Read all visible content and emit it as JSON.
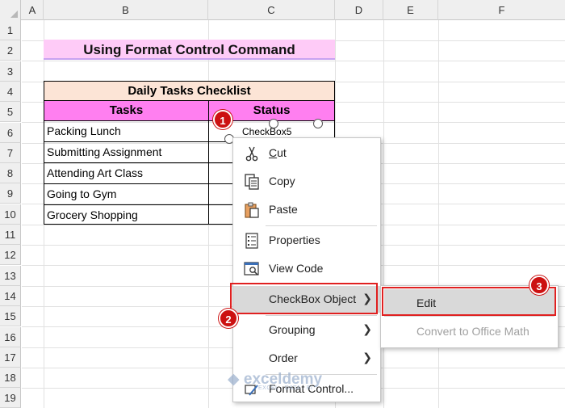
{
  "columns": [
    "A",
    "B",
    "C",
    "D",
    "E",
    "F"
  ],
  "rows": [
    "1",
    "2",
    "3",
    "4",
    "5",
    "6",
    "7",
    "8",
    "9",
    "10",
    "11",
    "12",
    "13",
    "14",
    "15",
    "16",
    "17",
    "18",
    "19"
  ],
  "sheet_title": "Using Format Control Command",
  "table": {
    "header": "Daily Tasks Checklist",
    "col_tasks": "Tasks",
    "col_status": "Status",
    "tasks": [
      "Packing Lunch",
      "Submitting Assignment",
      "Attending Art Class",
      "Going to Gym",
      "Grocery Shopping"
    ]
  },
  "checkbox_label": "CheckBox5",
  "badges": [
    "1",
    "2",
    "3"
  ],
  "context_menu": {
    "cut": "Cut",
    "copy": "Copy",
    "paste": "Paste",
    "properties": "Properties",
    "view_code": "View Code",
    "checkbox_object": "CheckBox Object",
    "grouping": "Grouping",
    "order": "Order",
    "format_control": "Format Control..."
  },
  "submenu": {
    "edit": "Edit",
    "convert": "Convert to Office Math"
  },
  "watermark": {
    "name": "exceldemy",
    "tagline": "EXCEL · DATA · BI"
  },
  "colors": {
    "title_fill": "#fecbf7",
    "table_header_fill": "#fce4d6",
    "column_header_fill": "#ff7ff0",
    "badge_red": "#cc1111",
    "highlight_border": "#e02020"
  }
}
